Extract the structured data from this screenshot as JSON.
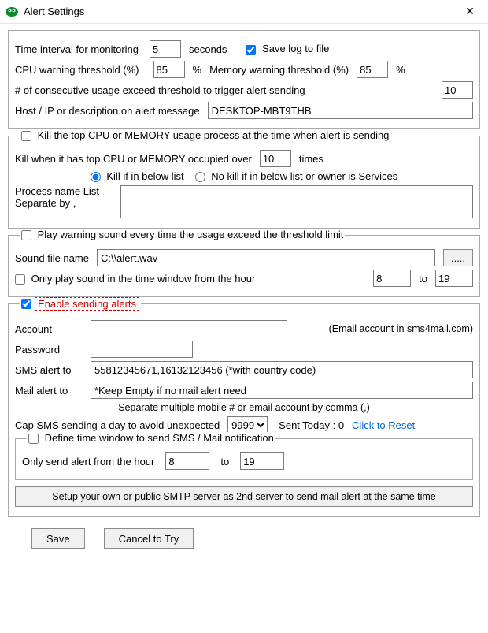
{
  "window": {
    "title": "Alert  Settings"
  },
  "monitoring": {
    "interval_label": "Time interval for monitoring",
    "interval_value": "5",
    "seconds_label": "seconds",
    "savelog_label": "Save log to file",
    "savelog_checked": true,
    "cpu_label": "CPU warning threshold (%)",
    "cpu_value": "85",
    "percent1": "%",
    "mem_label": "Memory warning threshold (%)",
    "mem_value": "85",
    "percent2": "%",
    "consec_label": "# of consecutive usage exceed threshold to trigger alert sending",
    "consec_value": "10",
    "host_label": "Host / IP or description on alert message",
    "host_value": "DESKTOP-MBT9THB"
  },
  "kill": {
    "check_label": "Kill the top CPU or MEMORY usage process at the time when alert is sending",
    "check_checked": false,
    "over_label_a": "Kill when it has top CPU or MEMORY occupied over",
    "over_value": "10",
    "over_label_b": "times",
    "radio_in": "Kill if in below list",
    "radio_out": "No kill if in below list or owner is Services",
    "radio_selected": "in",
    "list_label_a": "Process name List",
    "list_label_b": "Separate by ,",
    "list_value": ""
  },
  "sound": {
    "check_label": "Play warning sound every time the usage exceed the threshold limit",
    "check_checked": false,
    "file_label": "Sound file name",
    "file_value": "C:\\\\alert.wav",
    "browse_label": ".....",
    "window_check_label": "Only play sound in the time window from the hour",
    "window_check_checked": false,
    "from_value": "8",
    "to_label": "to",
    "to_value": "19"
  },
  "alerts": {
    "enable_checked": true,
    "enable_label": "Enable sending alerts",
    "account_label": "Account",
    "account_value": "",
    "account_hint": "(Email account in sms4mail.com)",
    "password_label": "Password",
    "password_value": "",
    "sms_label": "SMS alert to",
    "sms_value": "55812345671,16132123456 (*with country code)",
    "mail_label": "Mail alert to",
    "mail_value": "*Keep Empty if no mail alert need",
    "sep_hint": "Separate multiple mobile # or email account by comma (,)",
    "cap_label": "Cap SMS sending a day to avoid unexpected",
    "cap_value": "9999",
    "sent_today_label": "Sent Today : 0",
    "reset_label": "Click to Reset",
    "tw_check_label": "Define time window to send SMS / Mail notification",
    "tw_check_checked": false,
    "tw_from_label": "Only send alert from the hour",
    "tw_from_value": "8",
    "tw_to_label": "to",
    "tw_to_value": "19",
    "smtp_btn": "Setup your own or public SMTP server as 2nd server to send mail alert at the same time"
  },
  "footer": {
    "save": "Save",
    "cancel": "Cancel to Try"
  }
}
